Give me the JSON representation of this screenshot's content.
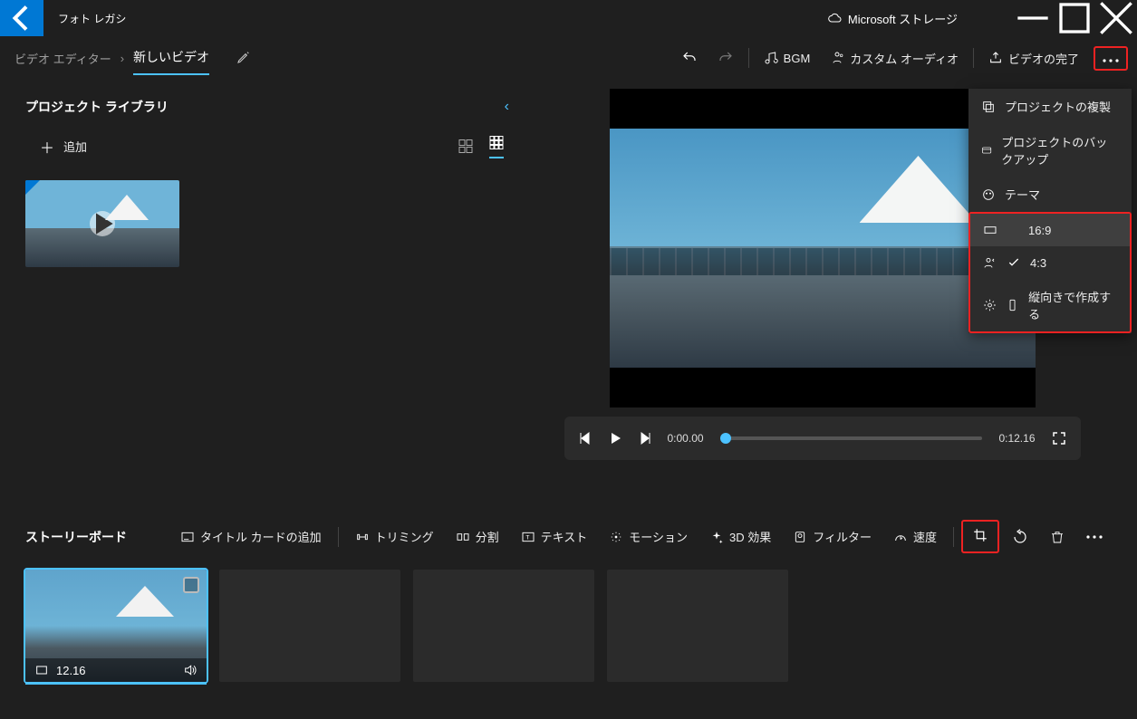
{
  "titlebar": {
    "app_name": "フォト レガシ",
    "storage_label": "Microsoft ストレージ"
  },
  "breadcrumb": {
    "root": "ビデオ エディター",
    "current": "新しいビデオ"
  },
  "toolbar": {
    "bgm": "BGM",
    "custom_audio": "カスタム オーディオ",
    "finish": "ビデオの完了"
  },
  "library": {
    "title": "プロジェクト ライブラリ",
    "add_label": "追加"
  },
  "player": {
    "current": "0:00.00",
    "total": "0:12.16"
  },
  "menu": {
    "duplicate": "プロジェクトの複製",
    "backup": "プロジェクトのバックアップ",
    "theme": "テーマ",
    "ratio_16_9": "16:9",
    "ratio_4_3": "4:3",
    "portrait": "縦向きで作成する"
  },
  "storyboard": {
    "title": "ストーリーボード",
    "add_title_card": "タイトル カードの追加",
    "trimming": "トリミング",
    "split": "分割",
    "text": "テキスト",
    "motion": "モーション",
    "effect_3d": "3D 効果",
    "filter": "フィルター",
    "speed": "速度",
    "clip_duration": "12.16"
  }
}
